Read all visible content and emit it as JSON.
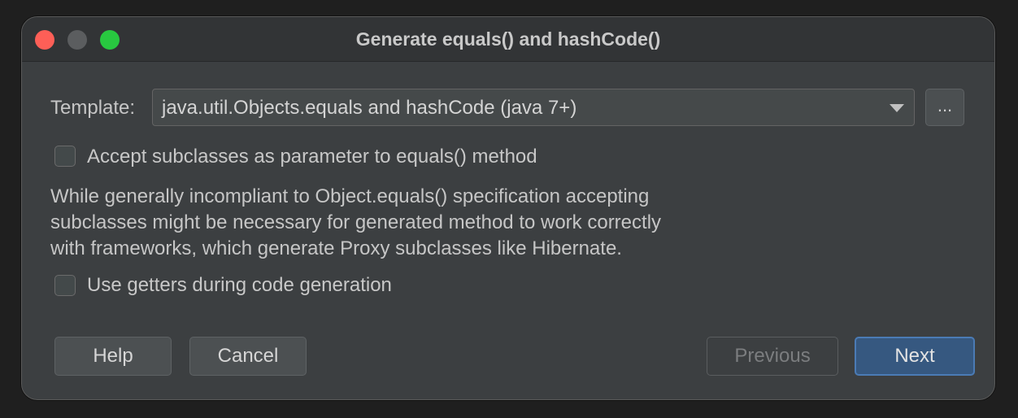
{
  "window": {
    "title": "Generate equals() and hashCode()"
  },
  "template": {
    "label": "Template:",
    "selected": "java.util.Objects.equals and hashCode (java 7+)",
    "more_label": "..."
  },
  "options": {
    "accept_subclasses": {
      "label": "Accept subclasses as parameter to equals() method",
      "checked": false
    },
    "description_lines": [
      "While generally incompliant to Object.equals() specification accepting",
      "subclasses might be necessary for generated method to work correctly",
      "with frameworks, which generate Proxy subclasses like Hibernate."
    ],
    "use_getters": {
      "label": "Use getters during code generation",
      "checked": false
    }
  },
  "buttons": {
    "help": "Help",
    "cancel": "Cancel",
    "previous": "Previous",
    "next": "Next"
  }
}
